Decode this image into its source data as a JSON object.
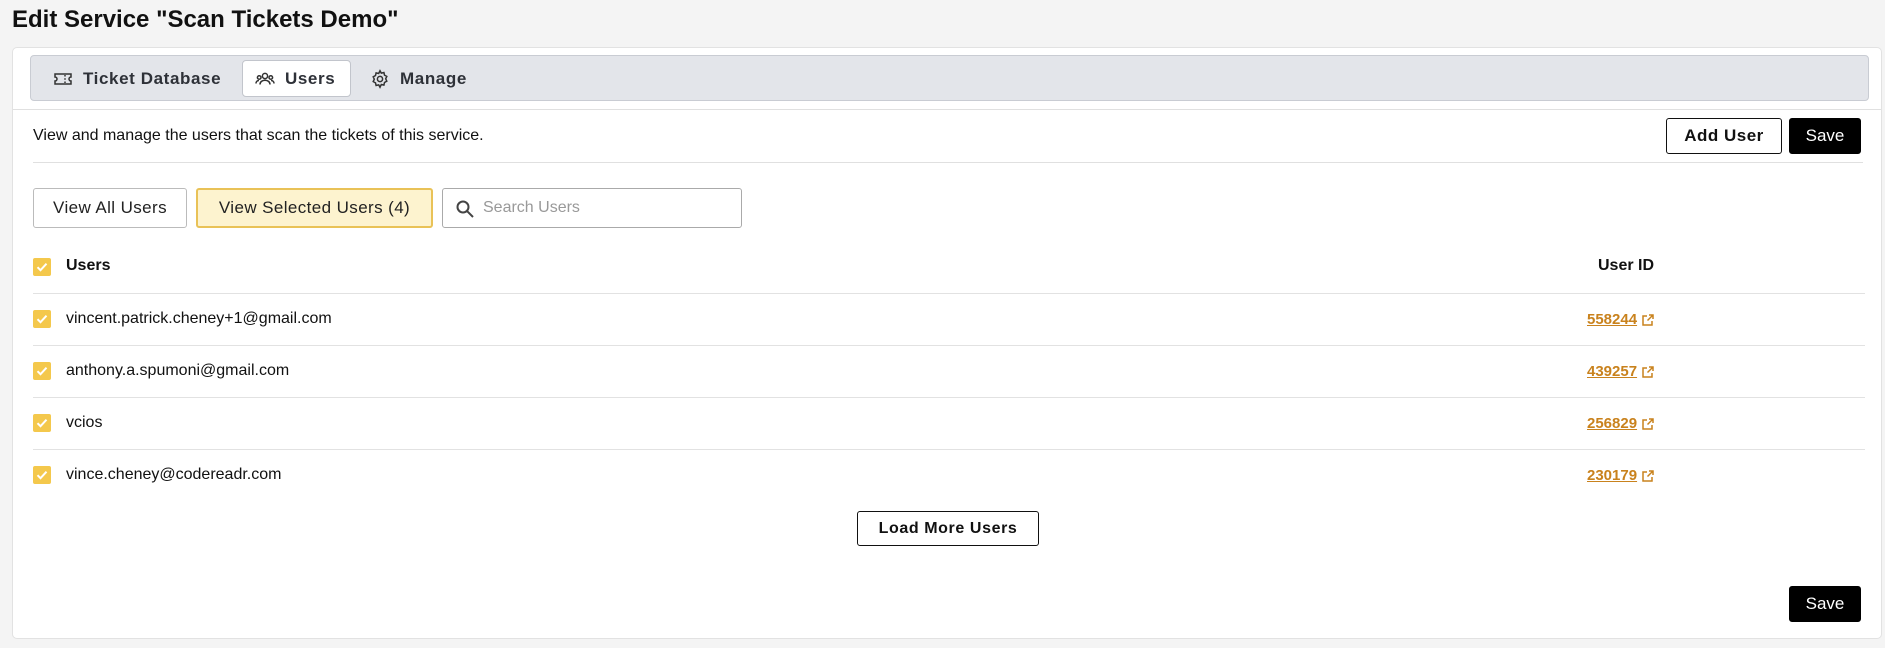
{
  "page": {
    "title": "Edit Service \"Scan Tickets Demo\""
  },
  "tabs": [
    {
      "label": "Ticket Database",
      "icon": "ticket-icon",
      "active": false
    },
    {
      "label": "Users",
      "icon": "users-icon",
      "active": true
    },
    {
      "label": "Manage",
      "icon": "gear-icon",
      "active": false
    }
  ],
  "users_panel": {
    "description": "View and manage the users that scan the tickets of this service.",
    "add_user_label": "Add User",
    "save_label": "Save",
    "view_all_label": "View All Users",
    "view_selected_label": "View Selected Users (4)",
    "search": {
      "placeholder": "Search Users",
      "value": "",
      "icon": "search-icon"
    },
    "table": {
      "columns": [
        "Users",
        "User ID"
      ],
      "header_checked": true,
      "rows": [
        {
          "email": "vincent.patrick.cheney+1@gmail.com",
          "user_id": "558244",
          "checked": true
        },
        {
          "email": "anthony.a.spumoni@gmail.com",
          "user_id": "439257",
          "checked": true
        },
        {
          "email": "vcios",
          "user_id": "256829",
          "checked": true
        },
        {
          "email": "vince.cheney@codereadr.com",
          "user_id": "230179",
          "checked": true
        }
      ]
    },
    "load_more_label": "Load More Users",
    "bottom_save_label": "Save"
  },
  "colors": {
    "accent": "#f4c84c",
    "selected_bg": "#fdf3cf",
    "selected_border": "#e9c257",
    "link": "#c9821d",
    "primary_button": "#000000"
  }
}
